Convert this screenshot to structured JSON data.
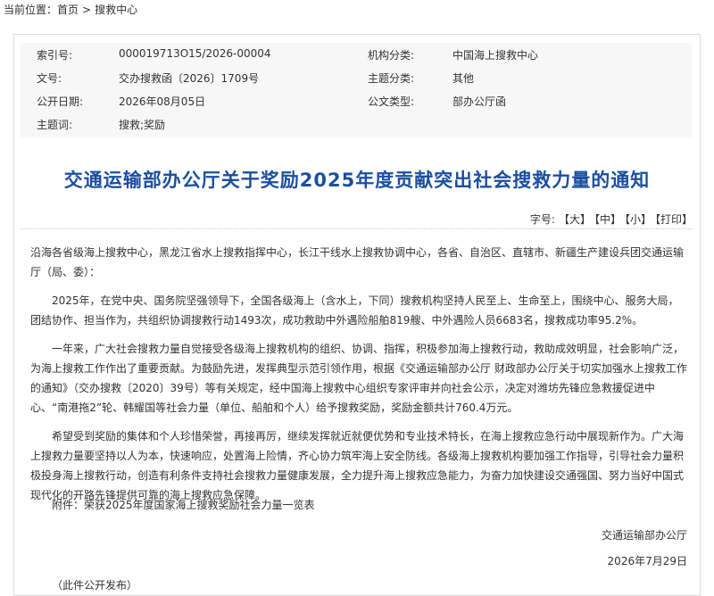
{
  "breadcrumb": {
    "label": "当前位置：",
    "home": "首页",
    "separator": ">",
    "current": "搜救中心"
  },
  "meta": {
    "index_label": "索引号:",
    "index_value": "000019713O15/2026-00004",
    "org_label": "机构分类:",
    "org_value": "中国海上搜救中心",
    "doc_label": "文号:",
    "doc_value": "交办搜救函〔2026〕1709号",
    "topic_label": "主题分类:",
    "topic_value": "其他",
    "date_label": "公开日期:",
    "date_value": "2026年08月05日",
    "type_label": "公文类型:",
    "type_value": "部办公厅函",
    "keywords_label": "主题词:",
    "keywords_value": "搜救;奖励"
  },
  "title": "交通运输部办公厅关于奖励2025年度贡献突出社会搜救力量的通知",
  "fontsize": {
    "label": "字号:",
    "large": "【大】",
    "medium": "【中】",
    "small": "【小】",
    "print": "【打印】"
  },
  "body": {
    "addressee": "沿海各省级海上搜救中心，黑龙江省水上搜救指挥中心，长江干线水上搜救协调中心，各省、自治区、直辖市、新疆生产建设兵团交通运输厅（局、委）：",
    "p1": "2025年，在党中央、国务院坚强领导下，全国各级海上（含水上，下同）搜救机构坚持人民至上、生命至上，围绕中心、服务大局，团结协作、担当作为，共组织协调搜救行动1493次，成功救助中外遇险船舶819艘、中外遇险人员6683名，搜救成功率95.2%。",
    "p2": "一年来，广大社会搜救力量自觉接受各级海上搜救机构的组织、协调、指挥，积极参加海上搜救行动，救助成效明显，社会影响广泛，为海上搜救工作作出了重要贡献。为鼓励先进，发挥典型示范引领作用，根据《交通运输部办公厅 财政部办公厅关于切实加强水上搜救工作的通知》（交办搜救〔2020〕39号）等有关规定，经中国海上搜救中心组织专家评审并向社会公示，决定对潍坊先锋应急救援促进中心、“南港拖2”轮、韩耀国等社会力量（单位、船舶和个人）给予搜救奖励，奖励金额共计760.4万元。",
    "p3": "希望受到奖励的集体和个人珍惜荣誉，再接再厉，继续发挥就近就便优势和专业技术特长，在海上搜救应急行动中展现新作为。广大海上搜救力量要坚持以人为本，快速响应，处置海上险情，齐心协力筑牢海上安全防线。各级海上搜救机构要加强工作指导，引导社会力量积极投身海上搜救行动，创造有利条件支持社会搜救力量健康发展，全力提升海上搜救应急能力，为奋力加快建设交通强国、努力当好中国式现代化的开路先锋提供可靠的海上搜救应急保障。",
    "attachment_label": "附件：",
    "attachment_link": "荣获2025年度国家海上搜救奖励社会力量一览表",
    "signer": "交通运输部办公厅",
    "date": "2026年7月29日",
    "note": "（此件公开发布）"
  }
}
